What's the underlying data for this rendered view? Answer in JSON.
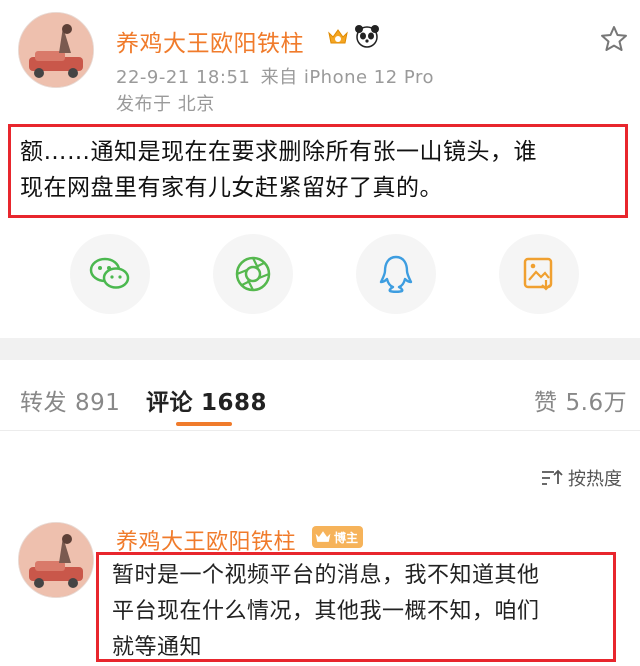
{
  "post": {
    "username": "养鸡大王欧阳铁柱",
    "timestamp": "22-9-21 18:51",
    "source": "来自 iPhone 12 Pro",
    "location": "发布于 北京",
    "text_line1": "额……通知是现在在要求删除所有张一山镜头，谁",
    "text_line2": "现在网盘里有家有儿女赶紧留好了真的。",
    "badges": [
      "crown-badge-icon",
      "panda-icon"
    ]
  },
  "share": {
    "items": [
      "wechat-icon",
      "moments-icon",
      "qq-icon",
      "save-image-icon"
    ]
  },
  "tabs": {
    "repost_label": "转发",
    "repost_count": "891",
    "comment_label": "评论",
    "comment_count": "1688",
    "like_label": "赞",
    "like_count": "5.6万"
  },
  "sort": {
    "label": "按热度"
  },
  "comment": {
    "username": "养鸡大王欧阳铁柱",
    "badge_label": "博主",
    "text_line1": "暂时是一个视频平台的消息，我不知道其他",
    "text_line2": "平台现在什么情况，其他我一概不知，咱们",
    "text_line3": "就等通知"
  },
  "colors": {
    "accent": "#f07b2b",
    "highlight": "#e8262d"
  }
}
